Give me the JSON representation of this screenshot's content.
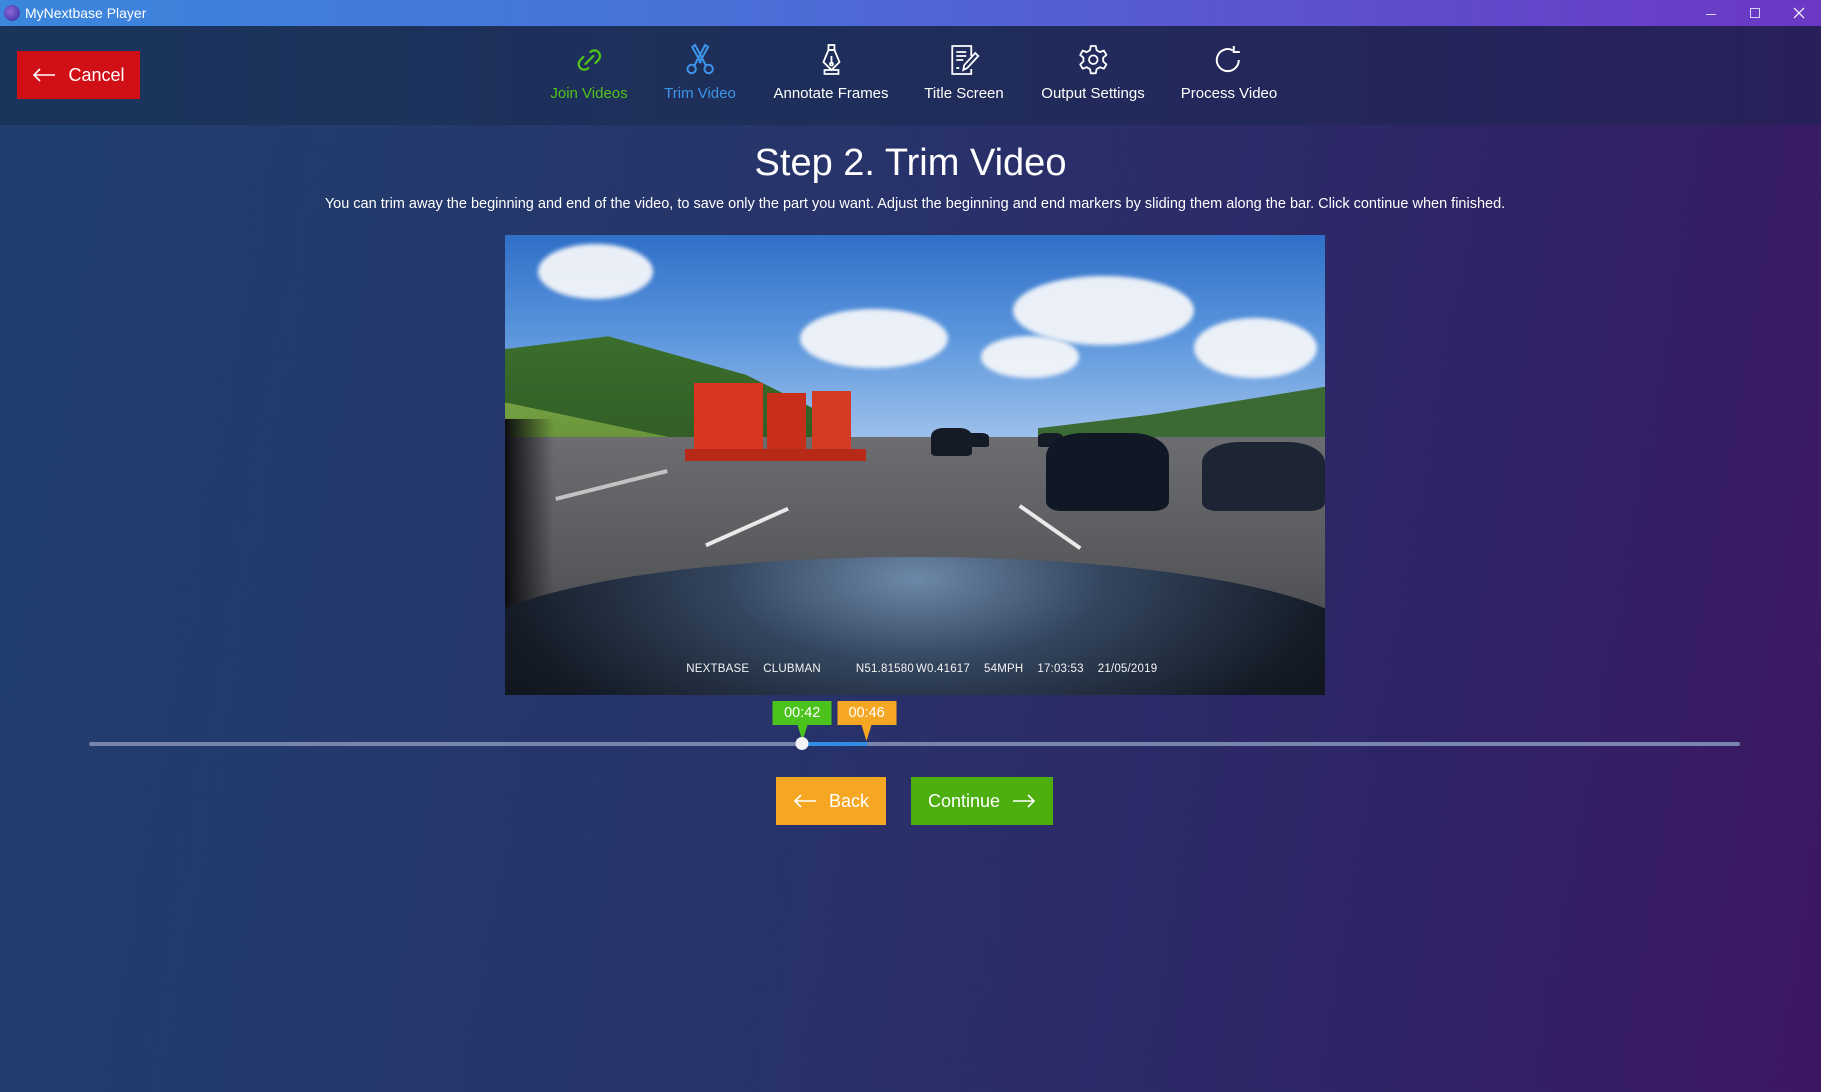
{
  "window": {
    "title": "MyNextbase Player",
    "controls": [
      "minimize-icon",
      "maximize-icon",
      "close-icon"
    ]
  },
  "header": {
    "cancel_label": "Cancel",
    "steps": [
      {
        "label": "Join Videos",
        "icon": "link-icon",
        "state": "completed"
      },
      {
        "label": "Trim Video",
        "icon": "scissors-icon",
        "state": "active"
      },
      {
        "label": "Annotate Frames",
        "icon": "pen-nib-icon",
        "state": "pending"
      },
      {
        "label": "Title Screen",
        "icon": "edit-document-icon",
        "state": "pending"
      },
      {
        "label": "Output Settings",
        "icon": "gear-icon",
        "state": "pending"
      },
      {
        "label": "Process Video",
        "icon": "refresh-icon",
        "state": "pending"
      }
    ]
  },
  "main": {
    "title": "Step 2. Trim Video",
    "description": "You can trim away the beginning and end of the video, to save only the part you want. Adjust the beginning and end markers by sliding them along the bar. Click continue when finished.",
    "video_overlay": {
      "brand": "NEXTBASE",
      "name": "CLUBMAN",
      "lat": "N51.81580",
      "lon": "W0.41617",
      "speed": "54MPH",
      "time": "17:03:53",
      "date": "21/05/2019"
    },
    "trim": {
      "start_label": "00:42",
      "end_label": "00:46",
      "start_fraction": 0.432,
      "end_fraction": 0.471,
      "colors": {
        "start": "#4cc21c",
        "end": "#f5a623",
        "selection": "#2f8de4"
      }
    },
    "back_label": "Back",
    "continue_label": "Continue"
  }
}
